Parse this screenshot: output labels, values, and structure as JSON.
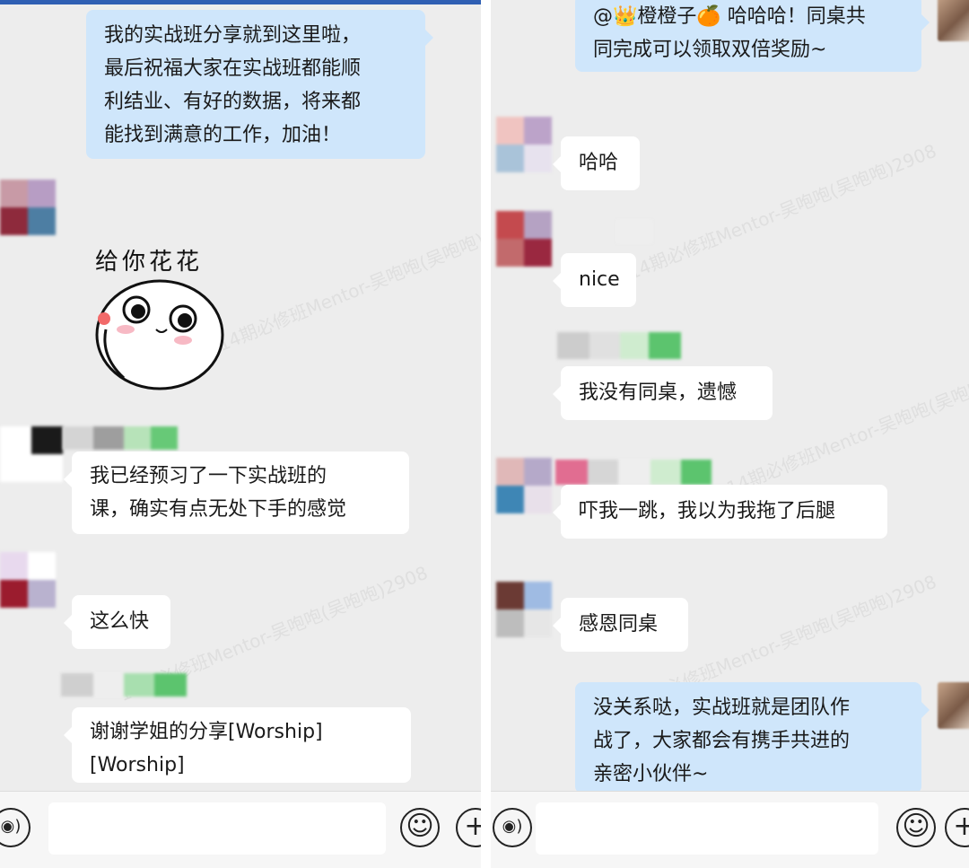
{
  "left_chat": {
    "messages": [
      {
        "lines": [
          "我的实战班分享就到这里啦，",
          "最后祝福大家在实战班都能顺",
          "利结业、有好的数据，将来都",
          "能找到满意的工作，加油！"
        ]
      },
      {
        "sticker_text": "给你花花"
      },
      {
        "lines": [
          "我已经预习了一下实战班的",
          "课，确实有点无处下手的感觉"
        ]
      },
      {
        "lines": [
          "这么快"
        ]
      },
      {
        "lines": [
          "谢谢学姐的分享[Worship]",
          "[Worship]"
        ]
      }
    ]
  },
  "right_chat": {
    "messages": [
      {
        "lines": [
          "@👑橙橙子🍊 哈哈哈！同桌共",
          "同完成可以领取双倍奖励~"
        ]
      },
      {
        "lines": [
          "哈哈"
        ]
      },
      {
        "lines": [
          "nice"
        ]
      },
      {
        "lines": [
          "我没有同桌，遗憾"
        ]
      },
      {
        "lines": [
          "吓我一跳，我以为我拖了后腿"
        ]
      },
      {
        "lines": [
          "感恩同桌"
        ]
      },
      {
        "lines": [
          "没关系哒，实战班就是团队作",
          "战了，大家都会有携手共进的",
          "亲密小伙伴~"
        ]
      }
    ]
  },
  "watermark": "14期必修班Mentor-吴咆咆(吴咆咆)2908",
  "icons": {
    "voice": "voice-icon",
    "emoji": "emoji-icon",
    "plus": "plus-icon"
  },
  "colors": {
    "background": "#ededed",
    "incoming_bubble": "#ffffff",
    "outgoing_bubble": "#cfe6fb",
    "top_accent": "#2f5fb3"
  }
}
